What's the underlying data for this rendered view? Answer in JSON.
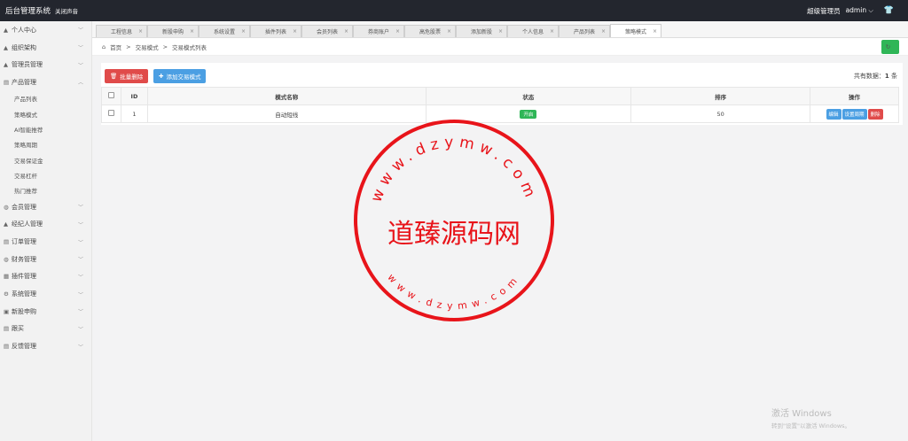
{
  "topbar": {
    "title": "后台管理系统",
    "mute_label": "关闭声音",
    "role": "超级管理员",
    "username": "admin"
  },
  "sidebar": {
    "items": [
      {
        "label": "个人中心",
        "icon": "user-icon",
        "glyph": "▲"
      },
      {
        "label": "组织架构",
        "icon": "org-icon",
        "glyph": "▲"
      },
      {
        "label": "管理员管理",
        "icon": "admin-icon",
        "glyph": "▲"
      },
      {
        "label": "产品管理",
        "icon": "product-icon",
        "glyph": "▤",
        "expanded": true,
        "children": [
          "产品列表",
          "策略模式",
          "AI智能推荐",
          "策略周期",
          "交易保证金",
          "交易杠杆",
          "热门推荐"
        ]
      },
      {
        "label": "会员管理",
        "icon": "member-icon",
        "glyph": "◍"
      },
      {
        "label": "经纪人管理",
        "icon": "broker-icon",
        "glyph": "▲"
      },
      {
        "label": "订单管理",
        "icon": "order-icon",
        "glyph": "▤"
      },
      {
        "label": "财务管理",
        "icon": "finance-icon",
        "glyph": "◍"
      },
      {
        "label": "插件管理",
        "icon": "plugin-icon",
        "glyph": "▦"
      },
      {
        "label": "系统管理",
        "icon": "system-icon",
        "glyph": "⚙"
      },
      {
        "label": "新股申购",
        "icon": "ipo-icon",
        "glyph": "▣"
      },
      {
        "label": "跟买",
        "icon": "follow-icon",
        "glyph": "▤"
      },
      {
        "label": "反馈管理",
        "icon": "feedback-icon",
        "glyph": "▤"
      }
    ]
  },
  "tabs": [
    {
      "label": "工程信息"
    },
    {
      "label": "新股申购"
    },
    {
      "label": "系统设置"
    },
    {
      "label": "插件列表"
    },
    {
      "label": "会员列表"
    },
    {
      "label": "券商账户"
    },
    {
      "label": "高危股票"
    },
    {
      "label": "添加新股"
    },
    {
      "label": "个人信息"
    },
    {
      "label": "产品列表"
    },
    {
      "label": "策略模式",
      "active": true
    }
  ],
  "breadcrumb": {
    "home": "首页",
    "sep": ">",
    "level1": "交易模式",
    "level2": "交易模式列表"
  },
  "toolbar": {
    "delete_label": "批量删除",
    "add_label": "添加交易模式",
    "total_prefix": "共有数据：",
    "total_count": "1",
    "total_suffix": "条"
  },
  "table": {
    "headers": [
      "",
      "ID",
      "模式名称",
      "状态",
      "排序",
      "操作"
    ],
    "rows": [
      {
        "id": "1",
        "name": "自动短线",
        "status": "开启",
        "sort": "50"
      }
    ],
    "actions": {
      "edit": "编辑",
      "period": "设置周期",
      "delete": "删除"
    }
  },
  "watermark": {
    "main": "道臻源码网",
    "ring_top": "www.dzymw.com",
    "ring_bottom": "www.dzymw.com",
    "color": "#e8141a"
  },
  "windows": {
    "line1": "激活 Windows",
    "line2": "转到\"设置\"以激活 Windows。"
  },
  "colors": {
    "topbar": "#23262e",
    "success": "#2fb657",
    "primary": "#4b9fe3",
    "danger": "#e04b4a"
  }
}
